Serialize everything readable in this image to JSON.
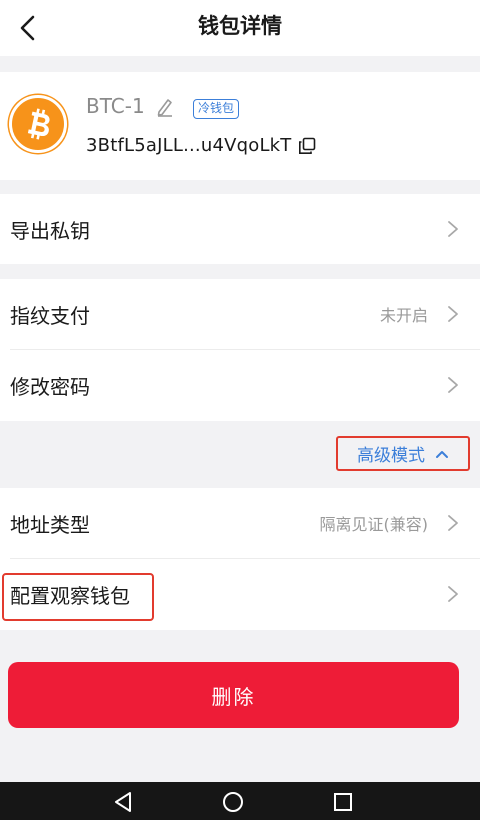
{
  "header": {
    "title": "钱包详情"
  },
  "wallet": {
    "name": "BTC-1",
    "badge": "冷钱包",
    "address": "3BtfL5aJLL...u4VqoLkT",
    "coin_color": "#f7931a"
  },
  "menu": {
    "export_key": {
      "label": "导出私钥"
    },
    "fingerprint": {
      "label": "指纹支付",
      "value": "未开启"
    },
    "change_password": {
      "label": "修改密码"
    },
    "advanced": {
      "label": "高级模式"
    },
    "address_type": {
      "label": "地址类型",
      "value": "隔离见证(兼容)"
    },
    "watch_wallet": {
      "label": "配置观察钱包"
    }
  },
  "actions": {
    "delete_label": "删除"
  },
  "colors": {
    "accent": "#3c7fd9",
    "danger": "#ee1c37",
    "highlight": "#e23b2e"
  }
}
